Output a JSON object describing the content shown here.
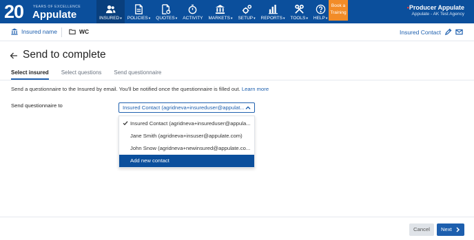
{
  "logo": {
    "anniversary": "20",
    "tagline": "YEARS OF EXCELLENCE",
    "brand": "Appulate"
  },
  "nav": {
    "items": [
      {
        "label": "INSURED",
        "icon": "people-icon",
        "caret": true,
        "active": true
      },
      {
        "label": "POLICIES",
        "icon": "document-icon",
        "caret": true
      },
      {
        "label": "QUOTES",
        "icon": "quote-document-icon",
        "caret": true
      },
      {
        "label": "ACTIVITY",
        "icon": "stopwatch-icon",
        "caret": false
      },
      {
        "label": "MARKETS",
        "icon": "bank-icon",
        "caret": true
      },
      {
        "label": "SETUP",
        "icon": "gears-icon",
        "caret": true
      },
      {
        "label": "REPORTS",
        "icon": "bar-chart-icon",
        "caret": true
      },
      {
        "label": "TOOLS",
        "icon": "tools-icon",
        "caret": true
      },
      {
        "label": "HELP",
        "icon": "question-icon",
        "caret": true
      }
    ],
    "training": {
      "line1": "Book a",
      "line2": "Training"
    },
    "producer": {
      "name": "Producer Appulate",
      "agency": "Appulate - AK Test Agency"
    },
    "caret_glyph": "▾"
  },
  "subheader": {
    "insured_name": "Insured name",
    "policy": "WC",
    "contact": "Insured Contact"
  },
  "page": {
    "title": "Send to complete",
    "steps": [
      "Select insured",
      "Select questions",
      "Send questionnaire"
    ],
    "description": "Send a questionnaire to the Insured by email. You'll be notified once the questionnaire is filled out.",
    "learn_more": "Learn more",
    "send_label": "Send questionnaire to",
    "selected": "Insured Contact (agridneva+insureduser@appulat...",
    "options": [
      {
        "label": "Insured Contact (agridneva+insureduser@appula...",
        "checked": true
      },
      {
        "label": "Jane Smith (agridneva+insuser@appulate.com)",
        "checked": false
      },
      {
        "label": "John Snow (agridneva+newinsured@appulate.co...",
        "checked": false
      },
      {
        "label": "Add new contact",
        "checked": false,
        "highlighted": true
      }
    ]
  },
  "footer": {
    "cancel": "Cancel",
    "next": "Next"
  },
  "colors": {
    "primary": "#0b4f9c",
    "accent": "#1d5fae",
    "training": "#f28c28"
  }
}
